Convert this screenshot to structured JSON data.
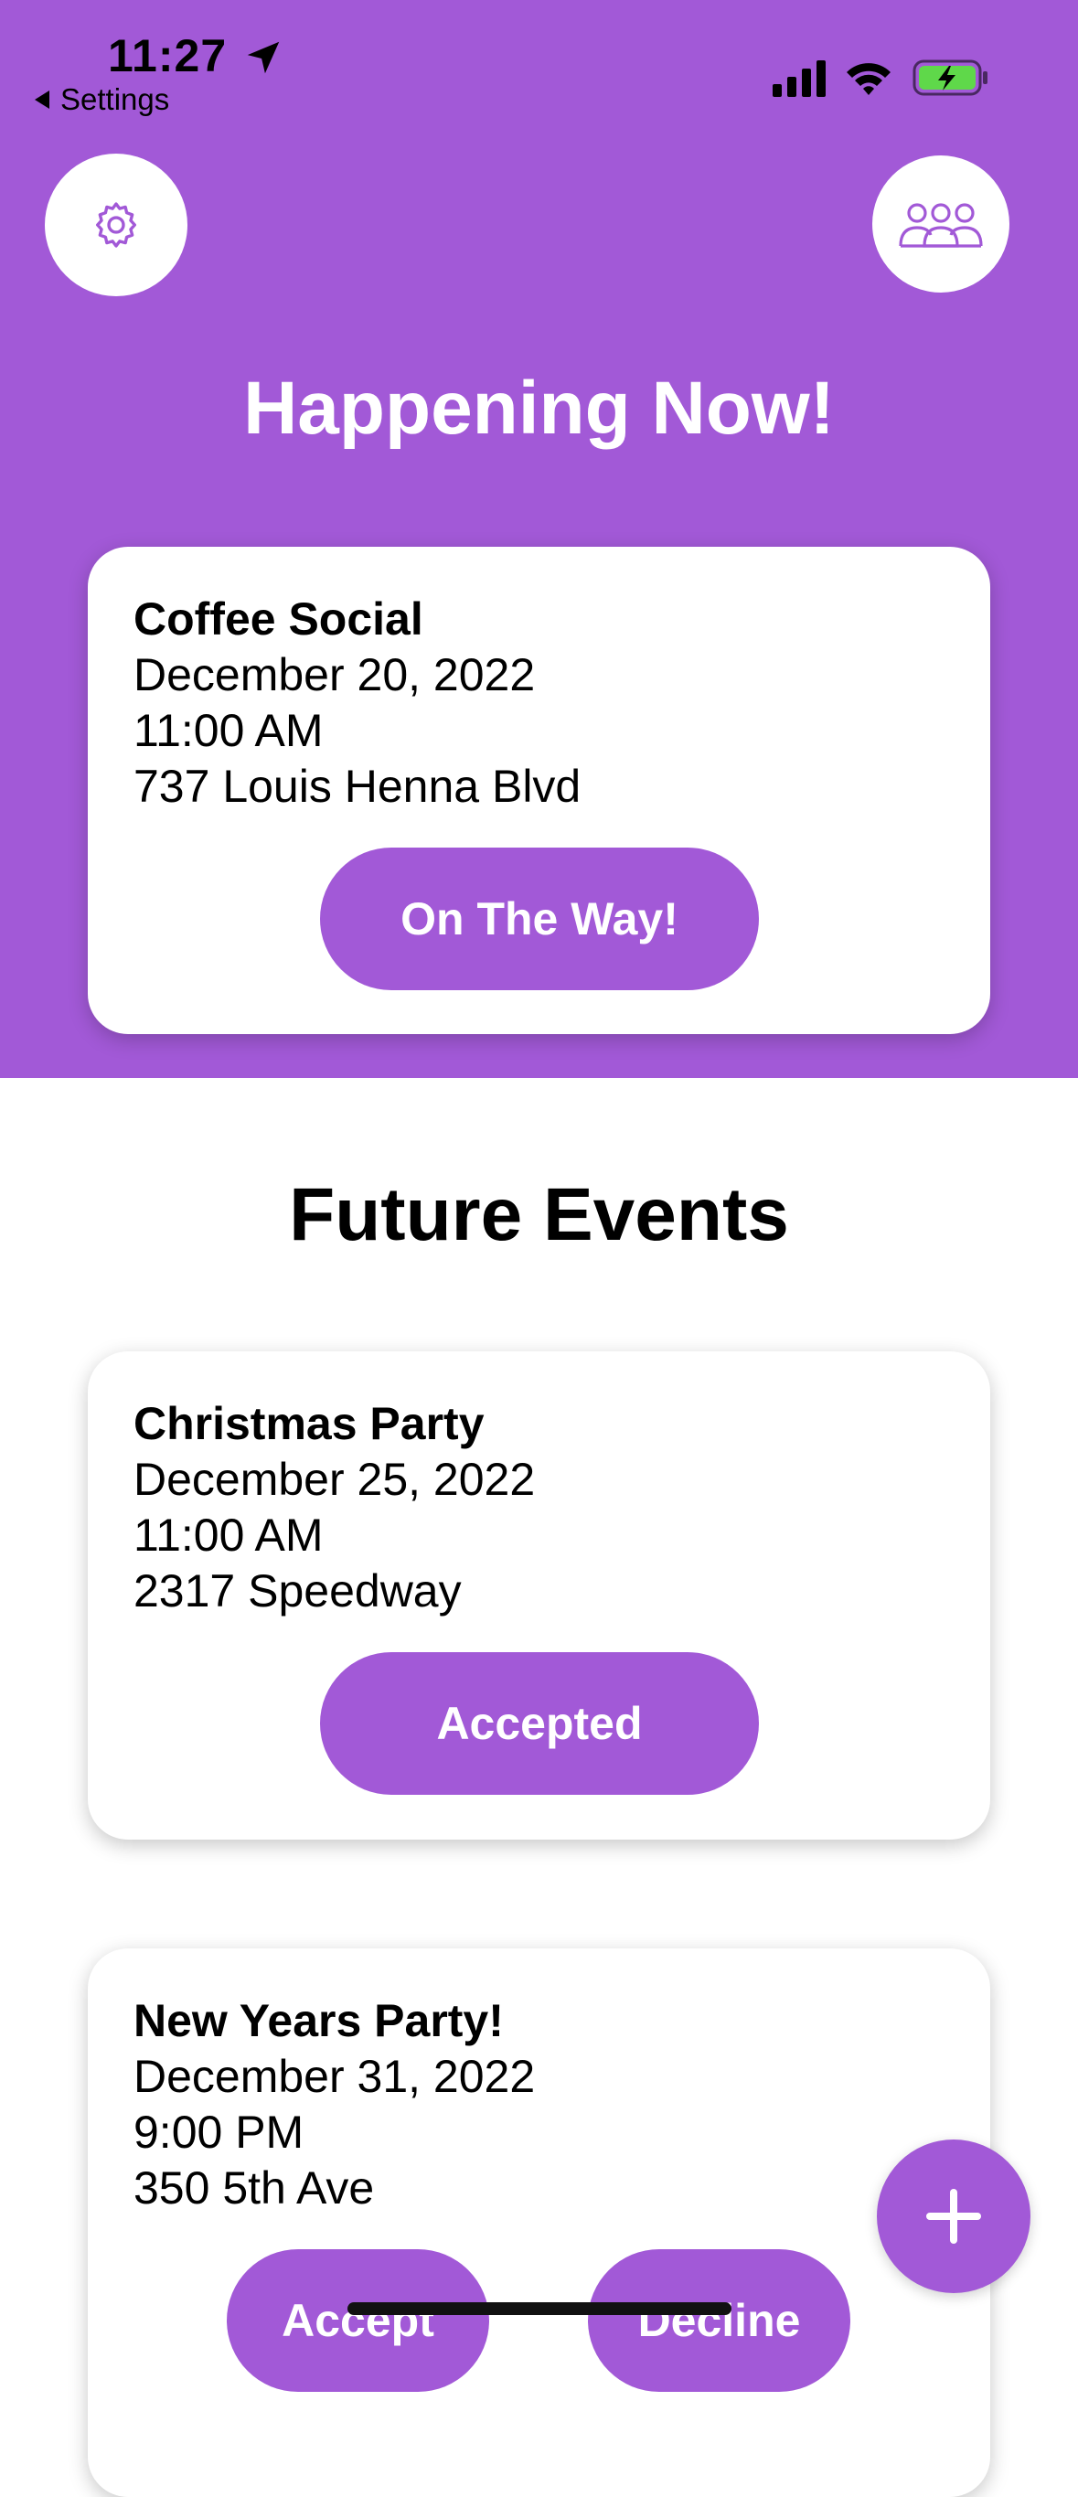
{
  "status_bar": {
    "time": "11:27",
    "back_label": "Settings",
    "icons": [
      "location-arrow-icon",
      "cellular-signal-icon",
      "wifi-icon",
      "battery-charging-icon"
    ]
  },
  "header": {
    "settings_icon": "gear-icon",
    "people_icon": "group-icon",
    "title": "Happening Now!"
  },
  "current_event": {
    "title": "Coffee Social",
    "date": "December 20, 2022",
    "time": "11:00 AM",
    "address": "737 Louis Henna Blvd",
    "action_label": "On The Way!"
  },
  "future_section": {
    "title": "Future Events",
    "events": [
      {
        "title": "Christmas Party",
        "date": "December 25, 2022",
        "time": "11:00 AM",
        "address": "2317 Speedway",
        "status_label": "Accepted"
      },
      {
        "title": "New Years Party!",
        "date": "December 31, 2022",
        "time": "9:00 PM",
        "address": "350 5th Ave",
        "accept_label": "Accept",
        "decline_label": "Decline"
      }
    ]
  },
  "fab": {
    "icon": "plus-icon"
  },
  "colors": {
    "accent": "#a259d7",
    "background": "#ffffff",
    "text": "#000000"
  }
}
